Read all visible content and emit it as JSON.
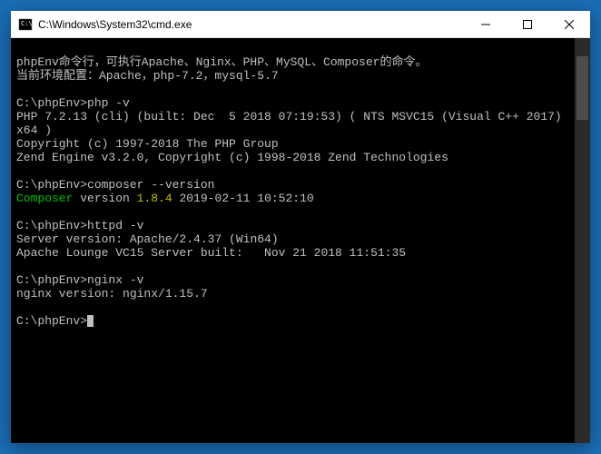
{
  "window": {
    "title": "C:\\Windows\\System32\\cmd.exe"
  },
  "terminal": {
    "intro1": "phpEnv命令行，可执行Apache、Nginx、PHP、MySQL、Composer的命令。",
    "intro2": "当前环境配置：Apache，php-7.2，mysql-5.7",
    "prompt": "C:\\phpEnv>",
    "cmd_php": "php -v",
    "php_out1": "PHP 7.2.13 (cli) (built: Dec  5 2018 07:19:53) ( NTS MSVC15 (Visual C++ 2017) x64 )",
    "php_out2": "Copyright (c) 1997-2018 The PHP Group",
    "php_out3": "Zend Engine v3.2.0, Copyright (c) 1998-2018 Zend Technologies",
    "cmd_composer": "composer --version",
    "composer_label": "Composer",
    "composer_mid": " version ",
    "composer_ver": "1.8.4",
    "composer_date": " 2019-02-11 10:52:10",
    "cmd_httpd": "httpd -v",
    "httpd_out1": "Server version: Apache/2.4.37 (Win64)",
    "httpd_out2": "Apache Lounge VC15 Server built:   Nov 21 2018 11:51:35",
    "cmd_nginx": "nginx -v",
    "nginx_out": "nginx version: nginx/1.15.7"
  }
}
